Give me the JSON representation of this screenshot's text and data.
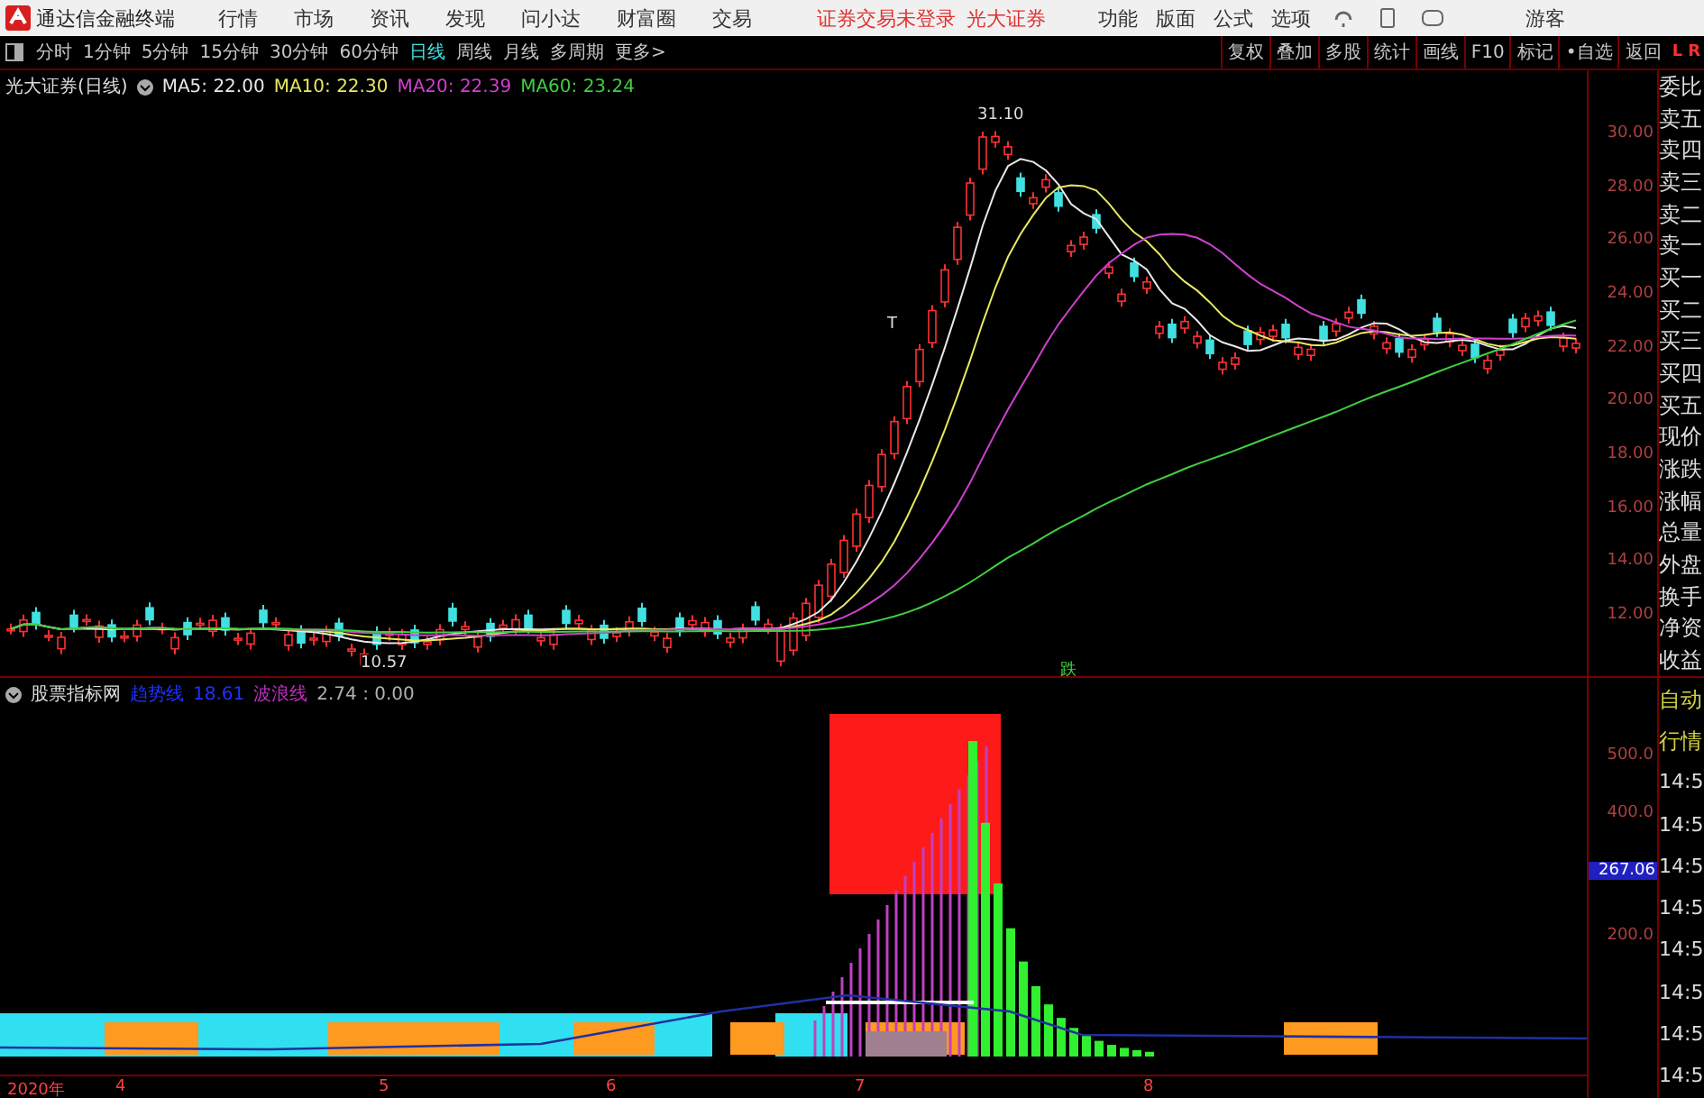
{
  "app": {
    "title": "通达信金融终端"
  },
  "menu": [
    "行情",
    "市场",
    "资讯",
    "发现",
    "问小达",
    "财富圈",
    "交易"
  ],
  "login_status": [
    "证券交易未登录",
    "光大证券"
  ],
  "tools": [
    "功能",
    "版面",
    "公式",
    "选项"
  ],
  "user": "游客",
  "periods": [
    {
      "label": "分时",
      "selected": false
    },
    {
      "label": "1分钟",
      "selected": false
    },
    {
      "label": "5分钟",
      "selected": false
    },
    {
      "label": "15分钟",
      "selected": false
    },
    {
      "label": "30分钟",
      "selected": false
    },
    {
      "label": "60分钟",
      "selected": false
    },
    {
      "label": "日线",
      "selected": true
    },
    {
      "label": "周线",
      "selected": false
    },
    {
      "label": "月线",
      "selected": false
    },
    {
      "label": "多周期",
      "selected": false
    },
    {
      "label": "更多>",
      "selected": false
    }
  ],
  "actions": [
    "复权",
    "叠加",
    "多股",
    "统计",
    "画线",
    "F10",
    "标记",
    "•自选",
    "返回"
  ],
  "corner_marks": [
    "L",
    "R"
  ],
  "main_chart": {
    "title": "光大证券(日线)",
    "indicators": [
      {
        "label": "MA5: 22.00",
        "color": "#e8e8e8"
      },
      {
        "label": "MA10: 22.30",
        "color": "#e8e860"
      },
      {
        "label": "MA20: 22.39",
        "color": "#d040d0"
      },
      {
        "label": "MA60: 23.24",
        "color": "#40d040"
      }
    ],
    "high_label": "31.10",
    "low_label": "10.57",
    "marks": [
      "T",
      "跌"
    ],
    "price_ticks": [
      "30.00",
      "28.00",
      "26.00",
      "24.00",
      "22.00",
      "20.00",
      "18.00",
      "16.00",
      "14.00",
      "12.00"
    ]
  },
  "indicator_panel": {
    "title": "股票指标网",
    "lines": [
      {
        "label": "趋势线",
        "color": "#2030ff"
      },
      {
        "label": "18.61",
        "color": "#2030ff"
      },
      {
        "label": "波浪线",
        "color": "#c030c0"
      },
      {
        "label": "2.74 : 0.00",
        "color": "#b0b0b0"
      }
    ],
    "ticks": [
      "500.0",
      "400.0",
      "200.0"
    ],
    "current": "267.06"
  },
  "x_axis": [
    "2020年",
    "4",
    "5",
    "6",
    "7",
    "8"
  ],
  "quote_labels": [
    "委比",
    "卖五",
    "卖四",
    "卖三",
    "卖二",
    "卖一",
    "买一",
    "买二",
    "买三",
    "买四",
    "买五",
    "现价",
    "涨跌",
    "涨幅",
    "总量",
    "外盘",
    "换手",
    "净资",
    "收益"
  ],
  "auto_labels": [
    "自动",
    "行情"
  ],
  "times": [
    "14:5",
    "14:5",
    "14:5",
    "14:5",
    "14:5",
    "14:5",
    "14:5",
    "14:5"
  ]
}
